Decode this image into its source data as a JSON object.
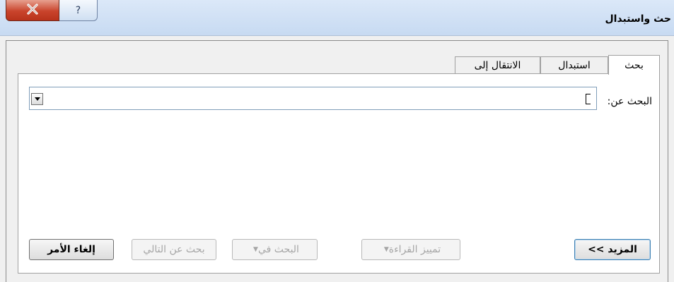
{
  "window": {
    "title": "حث واستبدال",
    "close_glyph": "X",
    "help_glyph": "?"
  },
  "tabs": [
    {
      "label": "بحث",
      "active": true
    },
    {
      "label": "استبدال",
      "active": false
    },
    {
      "label": "الانتقال إلى",
      "active": false
    }
  ],
  "find": {
    "label": "البحث عن:",
    "value": ""
  },
  "buttons": {
    "more": "المزيد >>",
    "reading_highlight": "تمييز القراءة",
    "find_in": "البحث في",
    "find_next": "بحث عن التالي",
    "cancel": "إلغاء الأمر",
    "dropdown_glyph": "▼"
  }
}
